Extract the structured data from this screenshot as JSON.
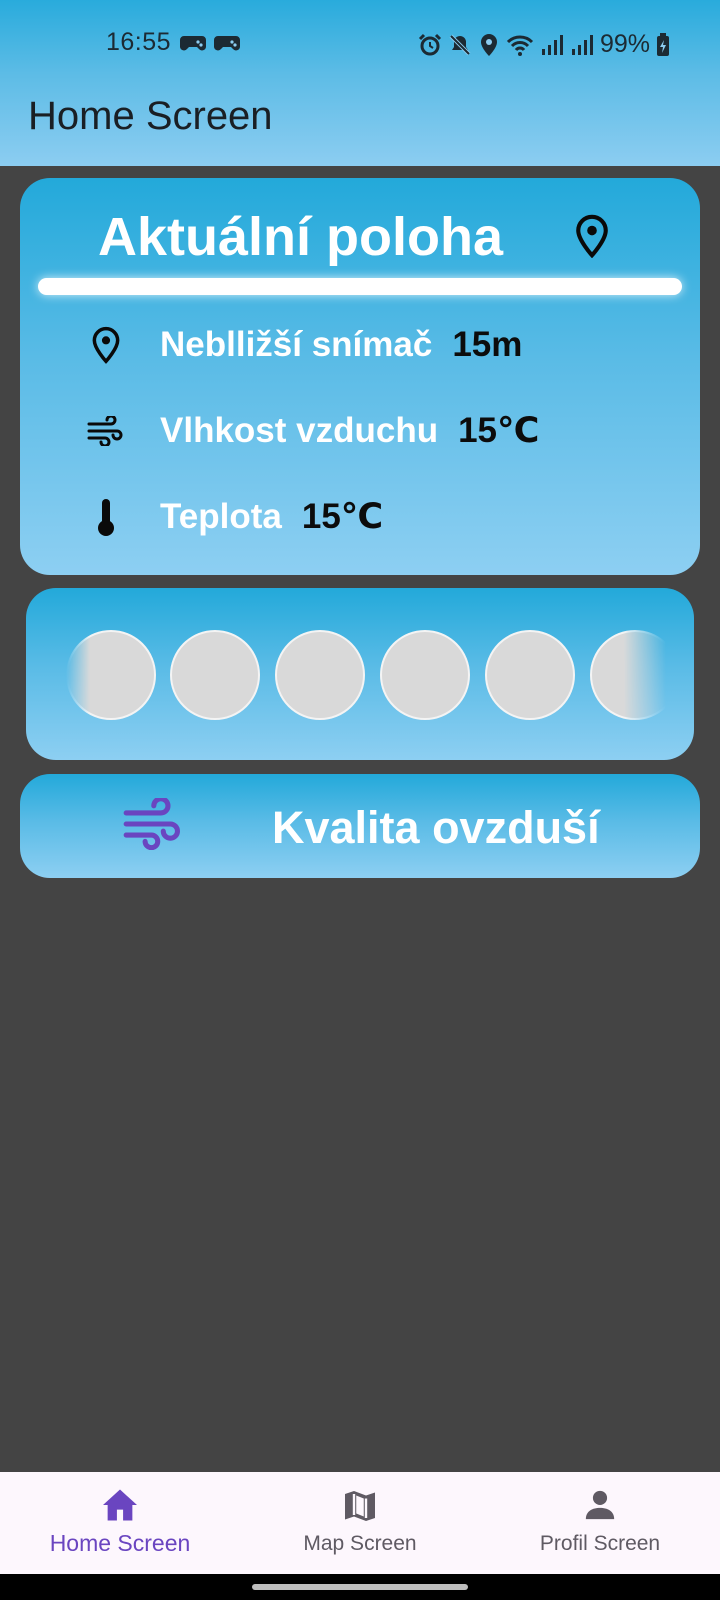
{
  "status_bar": {
    "time": "16:55",
    "battery": "99%",
    "icons": [
      "game-controller-icon",
      "game-controller-icon",
      "alarm-icon",
      "mute-icon",
      "location-icon",
      "wifi-icon",
      "signal-icon",
      "signal-icon",
      "battery-charging-icon"
    ]
  },
  "app_bar": {
    "title": "Home Screen"
  },
  "location_card": {
    "title": "Aktuální poloha",
    "title_icon": "location-pin-icon",
    "rows": [
      {
        "icon": "location-pin-icon",
        "label": "Neblližší snímač",
        "value": "15m"
      },
      {
        "icon": "wind-icon",
        "label": "Vlhkost vzduchu",
        "value": "15℃"
      },
      {
        "icon": "thermometer-icon",
        "label": "Teplota",
        "value": "15℃"
      }
    ]
  },
  "circles_card": {
    "count": 6
  },
  "air_quality_card": {
    "icon": "wind-icon",
    "label": "Kvalita ovzduší"
  },
  "bottom_nav": {
    "items": [
      {
        "icon": "home-icon",
        "label": "Home Screen",
        "active": true
      },
      {
        "icon": "map-icon",
        "label": "Map Screen",
        "active": false
      },
      {
        "icon": "person-icon",
        "label": "Profil Screen",
        "active": false
      }
    ]
  },
  "colors": {
    "accent": "#6a45c0",
    "card_top": "#23a9da",
    "card_bottom": "#8dcff2",
    "background": "#444444"
  }
}
